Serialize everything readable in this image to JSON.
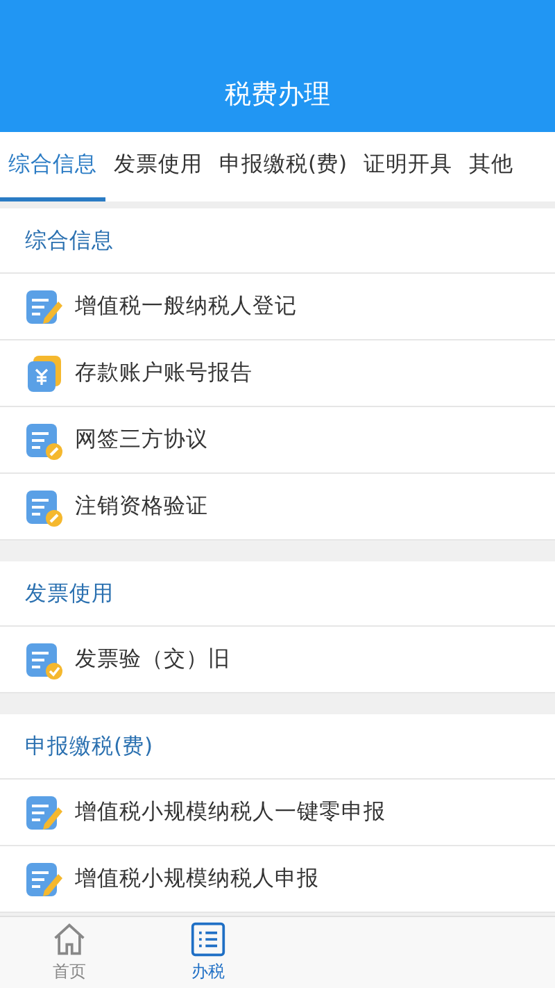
{
  "header": {
    "title": "税费办理"
  },
  "tabs": [
    {
      "label": "综合信息",
      "selected": true
    },
    {
      "label": "发票使用",
      "selected": false
    },
    {
      "label": "申报缴税(费)",
      "selected": false
    },
    {
      "label": "证明开具",
      "selected": false
    },
    {
      "label": "其他",
      "selected": false
    }
  ],
  "sections": [
    {
      "title": "综合信息",
      "items": [
        {
          "label": "增值税一般纳税人登记",
          "kind": "edit"
        },
        {
          "label": "存款账户账号报告",
          "kind": "money"
        },
        {
          "label": "网签三方协议",
          "kind": "link"
        },
        {
          "label": "注销资格验证",
          "kind": "link"
        }
      ]
    },
    {
      "title": "发票使用",
      "items": [
        {
          "label": "发票验（交）旧",
          "kind": "check"
        }
      ]
    },
    {
      "title": "申报缴税(费)",
      "items": [
        {
          "label": "增值税小规模纳税人一键零申报",
          "kind": "edit"
        },
        {
          "label": "增值税小规模纳税人申报",
          "kind": "edit"
        }
      ]
    }
  ],
  "bottom_nav": [
    {
      "label": "首页",
      "kind": "home",
      "selected": false
    },
    {
      "label": "办税",
      "kind": "list",
      "selected": true
    }
  ]
}
